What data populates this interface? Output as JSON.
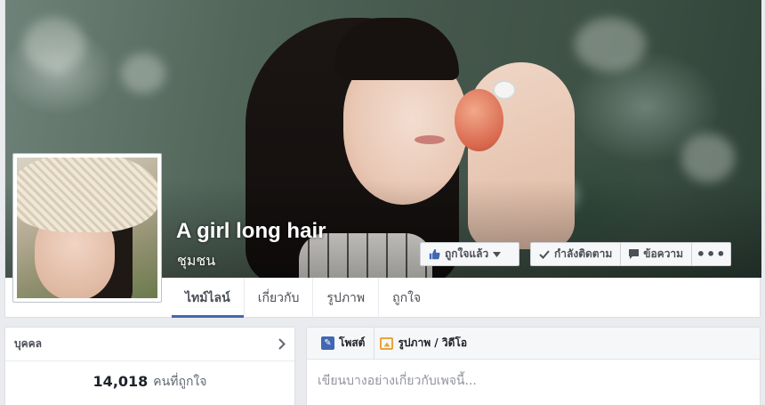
{
  "page": {
    "name": "A girl long hair",
    "category": "ชุมชน"
  },
  "actions": {
    "liked_label": "ถูกใจแล้ว",
    "following_label": "กำลังติดตาม",
    "message_label": "ข้อความ",
    "more_label": "•••"
  },
  "tabs": [
    {
      "label": "ไทม์ไลน์",
      "active": true
    },
    {
      "label": "เกี่ยวกับ"
    },
    {
      "label": "รูปภาพ"
    },
    {
      "label": "ถูกใจ"
    }
  ],
  "left_panel": {
    "title": "บุคคล",
    "likes_count": "14,018",
    "likes_text": "คนที่ถูกใจ"
  },
  "composer": {
    "post_tab": "โพสต์",
    "photo_tab": "รูปภาพ / วิดีโอ",
    "placeholder": "เขียนบางอย่างเกี่ยวกับเพจนี้..."
  },
  "colors": {
    "accent": "#4267b2",
    "background": "#e9ebee"
  },
  "icons": {
    "like": "thumbs-up-icon",
    "following": "checkmark-icon",
    "message": "speech-bubble-icon",
    "chevron": "chevron-right-icon",
    "post": "pencil-icon",
    "photo": "photo-icon"
  }
}
